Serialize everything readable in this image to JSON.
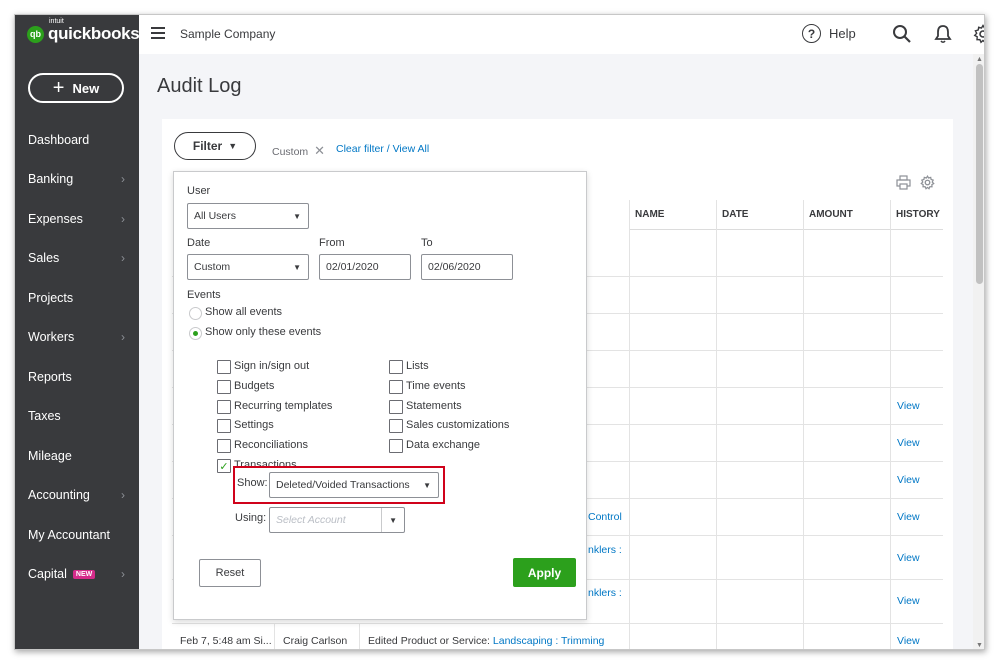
{
  "app": {
    "logo_small": "intuit",
    "logo_text": "quickbooks",
    "logo_mark": "qb",
    "new_button": "New"
  },
  "sidebar": {
    "items": [
      {
        "label": "Dashboard",
        "chevron": false
      },
      {
        "label": "Banking",
        "chevron": true
      },
      {
        "label": "Expenses",
        "chevron": true
      },
      {
        "label": "Sales",
        "chevron": true
      },
      {
        "label": "Projects",
        "chevron": false
      },
      {
        "label": "Workers",
        "chevron": true
      },
      {
        "label": "Reports",
        "chevron": false
      },
      {
        "label": "Taxes",
        "chevron": false
      },
      {
        "label": "Mileage",
        "chevron": false
      },
      {
        "label": "Accounting",
        "chevron": true
      },
      {
        "label": "My Accountant",
        "chevron": false
      },
      {
        "label": "Capital",
        "chevron": true,
        "badge": "NEW"
      }
    ]
  },
  "topbar": {
    "company": "Sample Company",
    "help_label": "Help",
    "help_glyph": "?",
    "icons": [
      "menu-icon",
      "help-icon",
      "search-icon",
      "bell-icon",
      "gear-icon"
    ]
  },
  "page": {
    "title": "Audit Log",
    "filter_button": "Filter",
    "filter_chip": "Custom",
    "clear_filter": "Clear filter / View All"
  },
  "table": {
    "columns": [
      "NAME",
      "DATE",
      "AMOUNT",
      "HISTORY"
    ],
    "view_label": "View",
    "partial_links": [
      "Control",
      "nklers :",
      "nklers :"
    ],
    "last_row": {
      "date_user": "Feb 7, 5:48 am Si...",
      "user": "Craig Carlson",
      "event_prefix": "Edited Product or Service:",
      "event_link": "Landscaping : Trimming",
      "history": "View"
    }
  },
  "filter_panel": {
    "user_label": "User",
    "user_value": "All Users",
    "date_label": "Date",
    "date_value": "Custom",
    "from_label": "From",
    "from_value": "02/01/2020",
    "to_label": "To",
    "to_value": "02/06/2020",
    "events_label": "Events",
    "show_all_events": "Show all events",
    "show_only_events": "Show only these events",
    "checkboxes_left": [
      {
        "label": "Sign in/sign out",
        "checked": false
      },
      {
        "label": "Budgets",
        "checked": false
      },
      {
        "label": "Recurring templates",
        "checked": false
      },
      {
        "label": "Settings",
        "checked": false
      },
      {
        "label": "Reconciliations",
        "checked": false
      },
      {
        "label": "Transactions",
        "checked": true
      }
    ],
    "checkboxes_right": [
      {
        "label": "Lists",
        "checked": false
      },
      {
        "label": "Time events",
        "checked": false
      },
      {
        "label": "Statements",
        "checked": false
      },
      {
        "label": "Sales customizations",
        "checked": false
      },
      {
        "label": "Data exchange",
        "checked": false
      }
    ],
    "show_label": "Show:",
    "show_value": "Deleted/Voided Transactions",
    "using_label": "Using:",
    "using_placeholder": "Select Account",
    "reset_button": "Reset",
    "apply_button": "Apply"
  },
  "colors": {
    "sidebar_bg": "#393a3d",
    "brand_green": "#2ca01c",
    "link_blue": "#0077c5",
    "highlight_red": "#d0021b",
    "badge_pink": "#d52b8a"
  }
}
